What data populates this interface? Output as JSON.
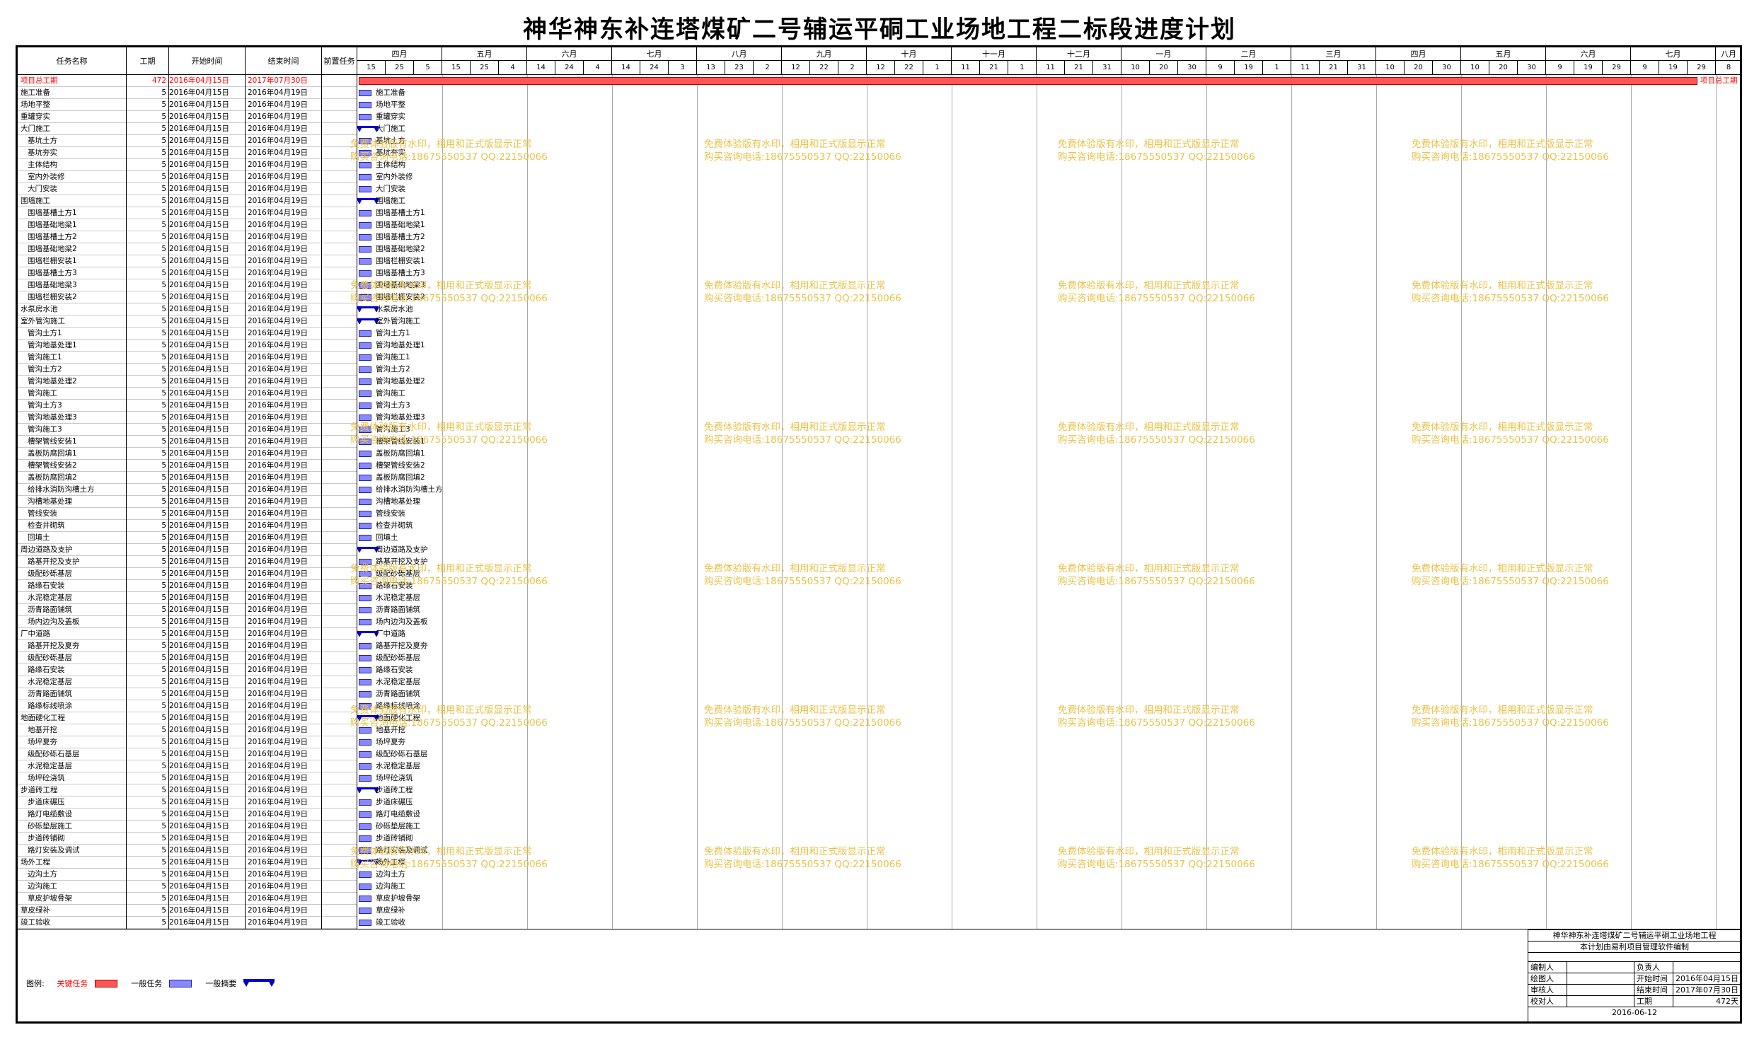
{
  "title": "神华神东补连塔煤矿二号辅运平硐工业场地工程二标段进度计划",
  "columns": {
    "name": "任务名称",
    "duration": "工期",
    "start": "开始时间",
    "end": "结束时间",
    "predecessor": "前置任务"
  },
  "months": [
    "四月",
    "五月",
    "六月",
    "七月",
    "八月",
    "九月",
    "十月",
    "十一月",
    "十二月",
    "一月",
    "二月",
    "三月",
    "四月",
    "五月",
    "六月",
    "七月",
    "八月"
  ],
  "days": [
    "15",
    "25",
    "5",
    "15",
    "25",
    "4",
    "14",
    "24",
    "4",
    "14",
    "24",
    "3",
    "13",
    "23",
    "2",
    "12",
    "22",
    "2",
    "12",
    "22",
    "1",
    "11",
    "21",
    "1",
    "11",
    "21",
    "31",
    "10",
    "20",
    "30",
    "9",
    "19",
    "1",
    "11",
    "21",
    "31",
    "10",
    "20",
    "30",
    "10",
    "20",
    "30",
    "9",
    "19",
    "29",
    "9",
    "19",
    "29",
    "8"
  ],
  "colors": {
    "critical": "#ff5555",
    "task": "#8888ff",
    "summary": "#0000cc",
    "watermark": "#e8c24a"
  },
  "critical_label": "项目总工期",
  "default_start": "2016年04月15日",
  "default_end": "2016年04月19日",
  "default_duration": "5",
  "tasks": [
    {
      "name": "项目总工期",
      "duration": "472",
      "start": "2016年04月15日",
      "end": "2017年07月30日",
      "level": 0,
      "kind": "critical"
    },
    {
      "name": "施工准备",
      "level": 0,
      "kind": "task"
    },
    {
      "name": "场地平整",
      "level": 0,
      "kind": "task"
    },
    {
      "name": "重罐穿实",
      "level": 0,
      "kind": "task"
    },
    {
      "name": "大门施工",
      "level": 0,
      "kind": "summary"
    },
    {
      "name": "基坑土方",
      "level": 1,
      "kind": "task"
    },
    {
      "name": "基坑夯实",
      "level": 1,
      "kind": "task"
    },
    {
      "name": "主体结构",
      "level": 1,
      "kind": "task"
    },
    {
      "name": "室内外装修",
      "level": 1,
      "kind": "task"
    },
    {
      "name": "大门安装",
      "level": 1,
      "kind": "task"
    },
    {
      "name": "围墙施工",
      "level": 0,
      "kind": "summary"
    },
    {
      "name": "围墙基槽土方1",
      "level": 1,
      "kind": "task"
    },
    {
      "name": "围墙基础地梁1",
      "level": 1,
      "kind": "task"
    },
    {
      "name": "围墙基槽土方2",
      "level": 1,
      "kind": "task"
    },
    {
      "name": "围墙基础地梁2",
      "level": 1,
      "kind": "task"
    },
    {
      "name": "围墙栏栅安装1",
      "level": 1,
      "kind": "task"
    },
    {
      "name": "围墙基槽土方3",
      "level": 1,
      "kind": "task"
    },
    {
      "name": "围墙基础地梁3",
      "level": 1,
      "kind": "task"
    },
    {
      "name": "围墙栏栅安装2",
      "level": 1,
      "kind": "task"
    },
    {
      "name": "水泵房水池",
      "level": 0,
      "kind": "summary"
    },
    {
      "name": "室外管沟施工",
      "level": 0,
      "kind": "summary"
    },
    {
      "name": "管沟土方1",
      "level": 1,
      "kind": "task"
    },
    {
      "name": "管沟地基处理1",
      "level": 1,
      "kind": "task"
    },
    {
      "name": "管沟施工1",
      "level": 1,
      "kind": "task"
    },
    {
      "name": "管沟土方2",
      "level": 1,
      "kind": "task"
    },
    {
      "name": "管沟地基处理2",
      "level": 1,
      "kind": "task"
    },
    {
      "name": "管沟施工",
      "level": 1,
      "kind": "task"
    },
    {
      "name": "管沟土方3",
      "level": 1,
      "kind": "task"
    },
    {
      "name": "管沟地基处理3",
      "level": 1,
      "kind": "task"
    },
    {
      "name": "管沟施工3",
      "level": 1,
      "kind": "task"
    },
    {
      "name": "槽架管线安装1",
      "level": 1,
      "kind": "task"
    },
    {
      "name": "盖板防腐回填1",
      "level": 1,
      "kind": "task"
    },
    {
      "name": "槽架管线安装2",
      "level": 1,
      "kind": "task"
    },
    {
      "name": "盖板防腐回填2",
      "level": 1,
      "kind": "task"
    },
    {
      "name": "给排水消防沟槽土方",
      "level": 1,
      "kind": "task"
    },
    {
      "name": "沟槽地基处理",
      "level": 1,
      "kind": "task"
    },
    {
      "name": "管线安装",
      "level": 1,
      "kind": "task"
    },
    {
      "name": "检查井砌筑",
      "level": 1,
      "kind": "task"
    },
    {
      "name": "回填土",
      "level": 1,
      "kind": "task"
    },
    {
      "name": "周边道路及支护",
      "level": 0,
      "kind": "summary"
    },
    {
      "name": "路基开挖及支护",
      "level": 1,
      "kind": "task"
    },
    {
      "name": "级配砂砾基层",
      "level": 1,
      "kind": "task"
    },
    {
      "name": "路缘石安装",
      "level": 1,
      "kind": "task"
    },
    {
      "name": "水泥稳定基层",
      "level": 1,
      "kind": "task"
    },
    {
      "name": "沥青路面铺筑",
      "level": 1,
      "kind": "task"
    },
    {
      "name": "场内边沟及盖板",
      "level": 1,
      "kind": "task"
    },
    {
      "name": "厂中道路",
      "level": 0,
      "kind": "summary"
    },
    {
      "name": "路基开挖及夏夯",
      "level": 1,
      "kind": "task"
    },
    {
      "name": "级配砂砾基层",
      "level": 1,
      "kind": "task"
    },
    {
      "name": "路缘石安装",
      "level": 1,
      "kind": "task"
    },
    {
      "name": "水泥稳定基层",
      "level": 1,
      "kind": "task"
    },
    {
      "name": "沥青路面铺筑",
      "level": 1,
      "kind": "task"
    },
    {
      "name": "路缘标线喷涂",
      "level": 1,
      "kind": "task"
    },
    {
      "name": "地面硬化工程",
      "level": 0,
      "kind": "summary"
    },
    {
      "name": "地基开挖",
      "level": 1,
      "kind": "task"
    },
    {
      "name": "场坪夏夯",
      "level": 1,
      "kind": "task"
    },
    {
      "name": "级配砂砾石基层",
      "level": 1,
      "kind": "task"
    },
    {
      "name": "水泥稳定基层",
      "level": 1,
      "kind": "task"
    },
    {
      "name": "场坪砼浇筑",
      "level": 1,
      "kind": "task"
    },
    {
      "name": "步道砖工程",
      "level": 0,
      "kind": "summary"
    },
    {
      "name": "步道床碾压",
      "level": 1,
      "kind": "task"
    },
    {
      "name": "路灯电缆敷设",
      "level": 1,
      "kind": "task"
    },
    {
      "name": "砂砾垫层施工",
      "level": 1,
      "kind": "task"
    },
    {
      "name": "步道砖铺砌",
      "level": 1,
      "kind": "task"
    },
    {
      "name": "路灯安装及调试",
      "level": 1,
      "kind": "task"
    },
    {
      "name": "场外工程",
      "level": 0,
      "kind": "summary"
    },
    {
      "name": "边沟土方",
      "level": 1,
      "kind": "task"
    },
    {
      "name": "边沟施工",
      "level": 1,
      "kind": "task"
    },
    {
      "name": "草皮护坡骨架",
      "level": 1,
      "kind": "task"
    },
    {
      "name": "草皮绿补",
      "level": 0,
      "kind": "task"
    },
    {
      "name": "竣工验收",
      "level": 0,
      "kind": "task"
    }
  ],
  "watermark": {
    "line1": "免费体验版有水印，相用和正式版显示正常",
    "line2": "购买咨询电话:18675550537 QQ:22150066"
  },
  "legend": {
    "label": "图例:",
    "critical": "关键任务",
    "task": "一般任务",
    "summary": "一般摘要"
  },
  "info": {
    "project": "神华神东补连塔煤矿二号辅运平硐工业场地工程",
    "software": "本计划由易利项目管理软件编制",
    "rows": [
      {
        "a": "编制人",
        "b": "",
        "c": "负责人",
        "d": ""
      },
      {
        "a": "绘图人",
        "b": "",
        "c": "开始时间",
        "d": "2016年04月15日"
      },
      {
        "a": "审核人",
        "b": "",
        "c": "结束时间",
        "d": "2017年07月30日"
      },
      {
        "a": "校对人",
        "b": "",
        "c": "工期",
        "d": "472天"
      }
    ],
    "date": "2016-06-12"
  }
}
